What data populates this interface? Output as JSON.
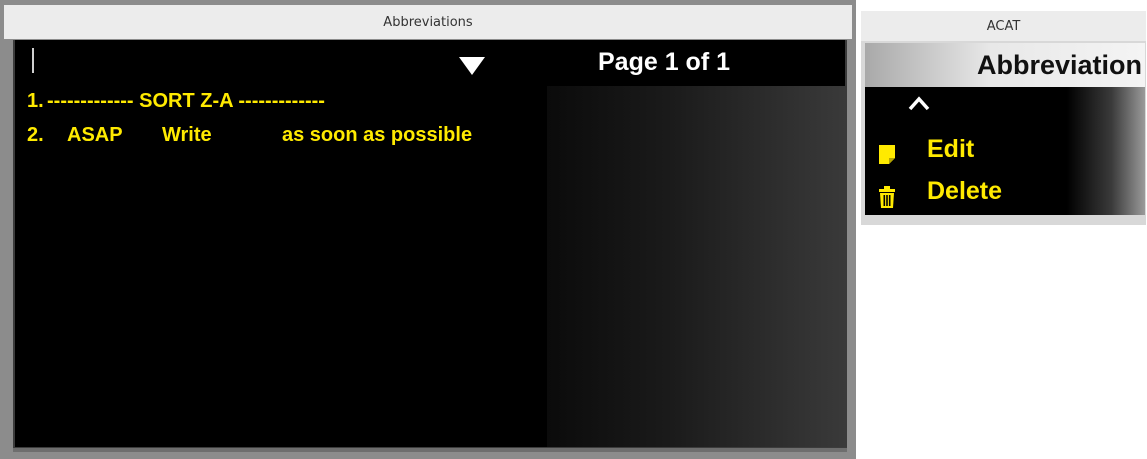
{
  "abbreviations_window": {
    "title": "Abbreviations",
    "page_indicator": "Page 1 of 1",
    "items": [
      {
        "number": "1.",
        "text": "------------- SORT Z-A -------------"
      },
      {
        "number": "2.",
        "abbreviation": "ASAP",
        "mode": "Write",
        "expansion": "as soon as possible"
      }
    ]
  },
  "acat_window": {
    "title": "ACAT",
    "header": "Abbreviation",
    "menu": [
      {
        "label": "Edit",
        "icon": "note-icon"
      },
      {
        "label": "Delete",
        "icon": "trash-icon"
      }
    ]
  },
  "colors": {
    "highlight_text": "#ffea00",
    "panel_background": "#000000",
    "titlebar": "#ececec"
  }
}
